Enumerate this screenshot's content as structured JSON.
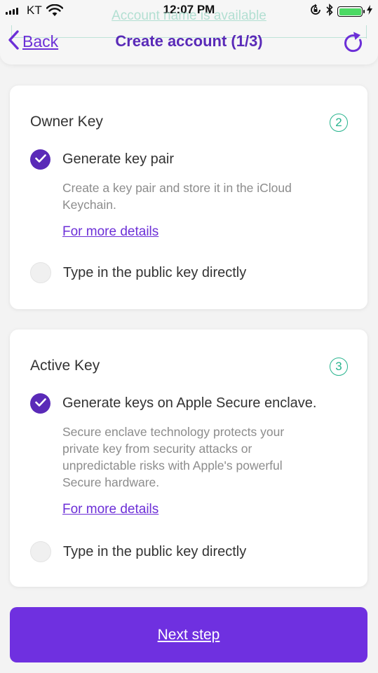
{
  "status_bar": {
    "carrier": "KT",
    "time": "12:07 PM"
  },
  "header": {
    "faded_message": "Account name is available",
    "back_label": "Back",
    "title": "Create account (1/3)"
  },
  "owner_key": {
    "title": "Owner Key",
    "step": "2",
    "option_generate": "Generate key pair",
    "option_generate_checked": true,
    "description": "Create a key pair and store it in the iCloud Keychain.",
    "details_link": "For more details",
    "option_public": "Type in the public key directly",
    "option_public_checked": false
  },
  "active_key": {
    "title": "Active Key",
    "step": "3",
    "option_generate": "Generate keys on Apple Secure enclave.",
    "option_generate_checked": true,
    "description": "Secure enclave technology protects your private key from security attacks or unpredictable risks with Apple's powerful Secure hardware.",
    "details_link": "For more details",
    "option_public": "Type in the public key directly",
    "option_public_checked": false
  },
  "next_button": "Next step",
  "colors": {
    "accent": "#6f30e0",
    "title_purple": "#5a2ab8",
    "step_green": "#28b48e",
    "battery_green": "#4cd964"
  }
}
